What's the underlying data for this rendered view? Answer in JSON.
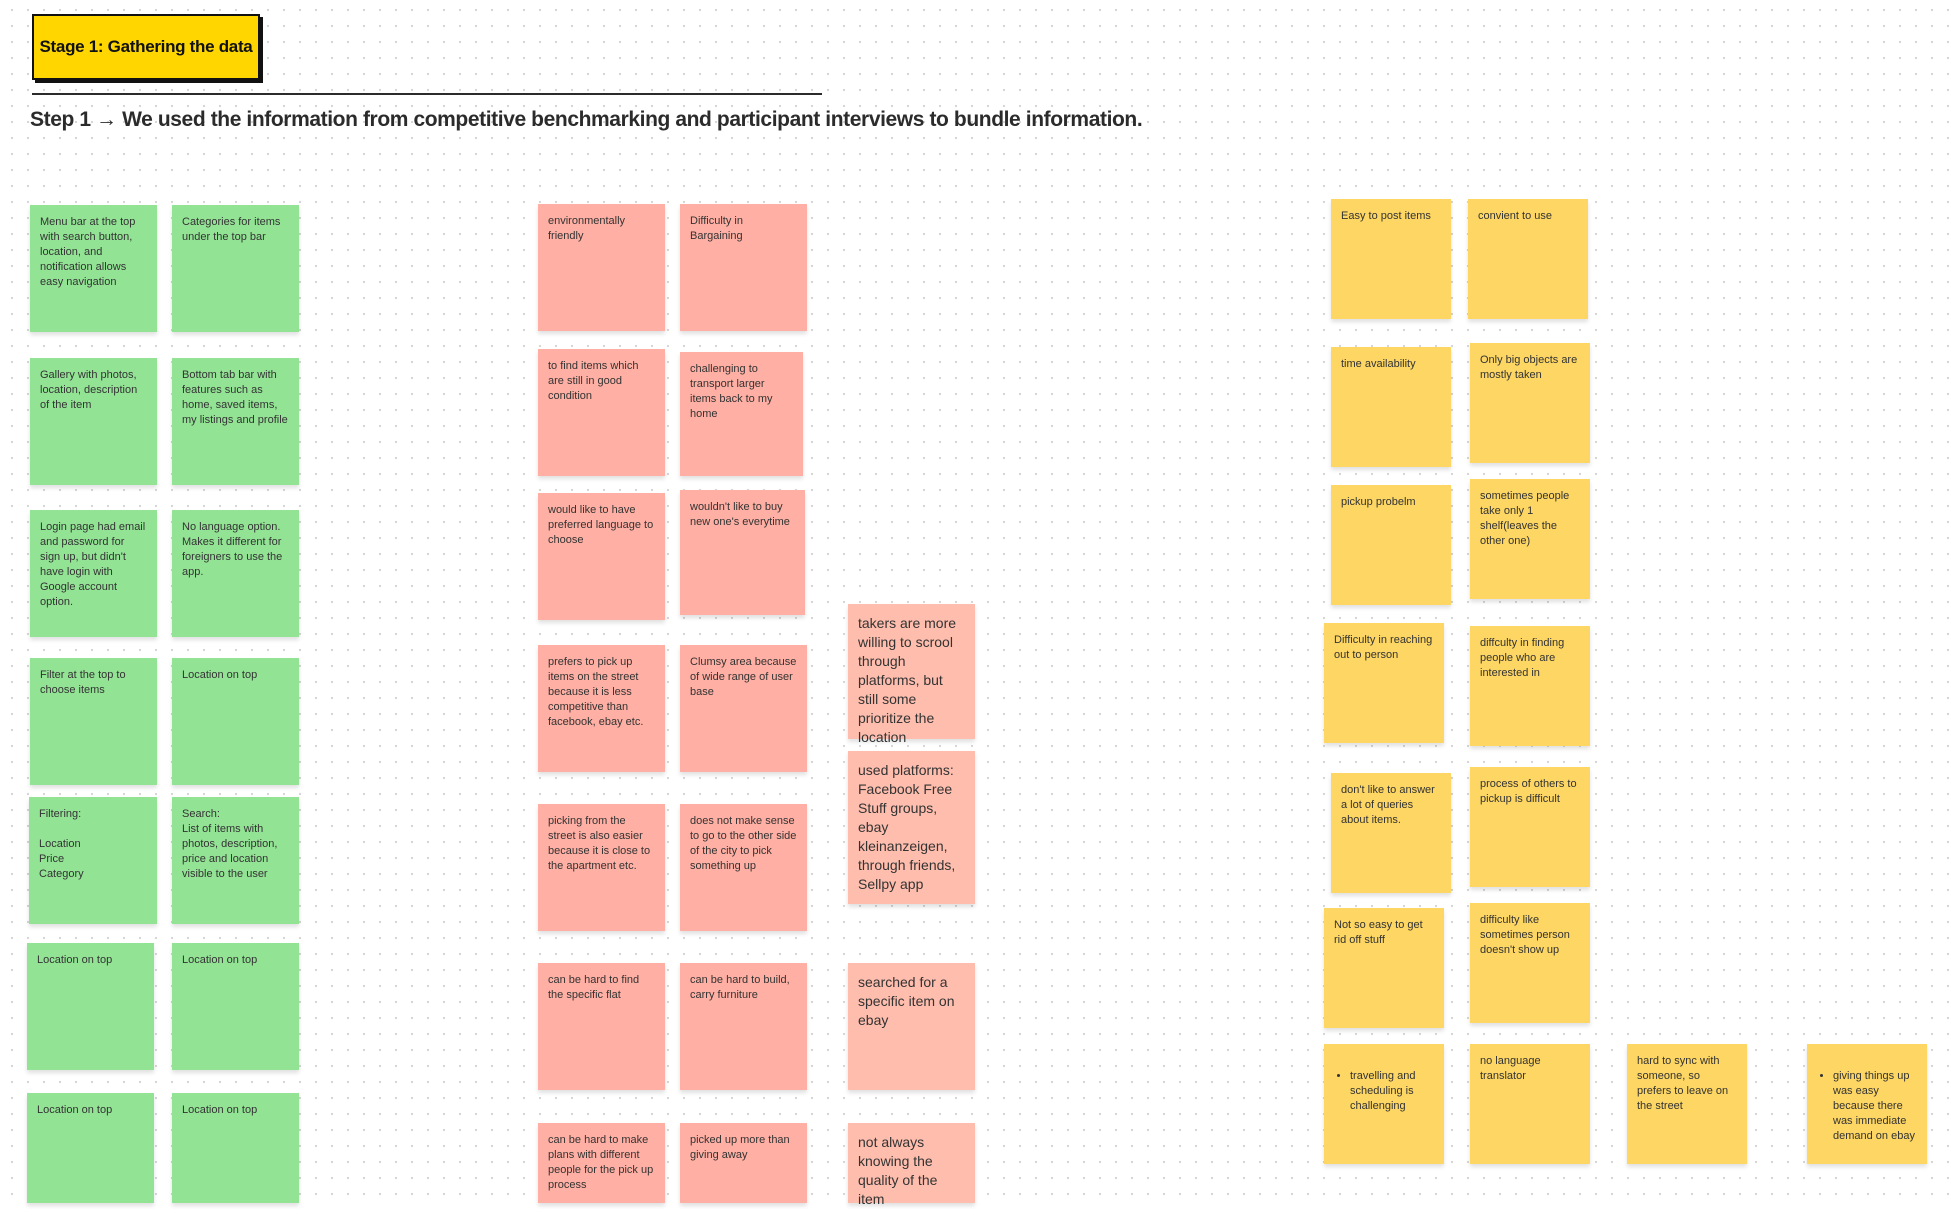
{
  "header": {
    "stage_title": "Stage 1: Gathering the data",
    "step_heading": "Step 1 → We used the information from competitive benchmarking and participant interviews to bundle information."
  },
  "colors": {
    "stage_box": "#FFD600",
    "green_note": "#93E395",
    "red_note": "#FFAFA3",
    "salmon_note": "#FFBDAD",
    "yellow_note": "#FDD663"
  },
  "green_notes": [
    {
      "text": "Menu bar at the top with search button, location, and notification allows easy navigation"
    },
    {
      "text": "Categories for items under the top bar"
    },
    {
      "text": "Gallery with photos, location, description of the item"
    },
    {
      "text": "Bottom tab bar with features such as home, saved items, my listings and profile"
    },
    {
      "text": "Login page had email and password for sign up, but didn't have login with Google account option."
    },
    {
      "text": "No language option. Makes it different for foreigners to use the app."
    },
    {
      "text": "Filter at the top to choose items"
    },
    {
      "text": "Location on top"
    },
    {
      "text": "Filtering:\n\nLocation\nPrice\nCategory"
    },
    {
      "text": "Search:\nList of items with photos, description, price and location visible to the user"
    },
    {
      "text": "Location on top"
    },
    {
      "text": "Location on top"
    },
    {
      "text": "Location on top"
    },
    {
      "text": "Location on top"
    }
  ],
  "red_notes": [
    {
      "text": "environmentally friendly"
    },
    {
      "text": "Difficulty in Bargaining"
    },
    {
      "text": "to find items which are still in good condition"
    },
    {
      "text": "challenging to transport larger items back to my home"
    },
    {
      "text": "would like to have preferred language to choose"
    },
    {
      "text": "wouldn't like to buy new one's everytime"
    },
    {
      "text": "prefers to pick up items on the street because it is less competitive than facebook, ebay etc."
    },
    {
      "text": "Clumsy area because of wide range of user base"
    },
    {
      "text": "picking from the street is also easier because it is close to the apartment etc."
    },
    {
      "text": "does not make sense to go to the other side of the city to pick something up"
    },
    {
      "text": "can be hard to find the specific flat"
    },
    {
      "text": "can be hard to build, carry furniture"
    },
    {
      "text": "can be hard to make plans with different people for the pick up process"
    },
    {
      "text": "picked up more than giving away"
    }
  ],
  "salmon_notes": [
    {
      "text": "takers are more willing to scrool through platforms, but still some prioritize the location"
    },
    {
      "text": "used platforms: Facebook Free Stuff groups, ebay kleinanzeigen, through friends, Sellpy app"
    },
    {
      "text": "searched for a specific item on ebay"
    },
    {
      "text": "not always knowing the quality of the item"
    }
  ],
  "yellow_notes": [
    {
      "text": "Easy to post items"
    },
    {
      "text": "convient to use"
    },
    {
      "text": "time availability"
    },
    {
      "text": "Only big objects are mostly taken"
    },
    {
      "text": "pickup probelm"
    },
    {
      "text": "sometimes people take only 1 shelf(leaves the other one)"
    },
    {
      "text": "Difficulty in reaching out to person"
    },
    {
      "text": "diffculty in finding people who are interested in"
    },
    {
      "text": "don't like to answer a lot of queries about items."
    },
    {
      "text": "process of others to pickup is difficult"
    },
    {
      "text": "Not so easy to get rid off stuff"
    },
    {
      "text": "difficulty like sometimes person doesn't show up"
    },
    {
      "text": "travelling and scheduling is challenging",
      "bullet": true
    },
    {
      "text": "no language translator"
    },
    {
      "text": "hard to sync with someone, so prefers to leave on the street"
    },
    {
      "text": "giving things up was easy because there was immediate demand on ebay",
      "bullet": true
    }
  ]
}
